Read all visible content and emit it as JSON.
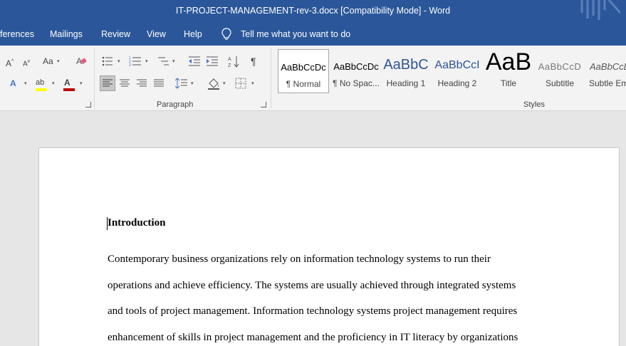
{
  "window": {
    "title": "IT-PROJECT-MANAGEMENT-rev-3.docx [Compatibility Mode]  -  Word"
  },
  "menu": {
    "items": [
      "ferences",
      "Mailings",
      "Review",
      "View",
      "Help"
    ],
    "tell_me": "Tell me what you want to do"
  },
  "ribbon": {
    "paragraph_label": "Paragraph",
    "styles_label": "Styles",
    "styles": [
      {
        "preview": "AaBbCcDc",
        "label": "¶ Normal"
      },
      {
        "preview": "AaBbCcDc",
        "label": "¶ No Spac..."
      },
      {
        "preview": "AaBbC",
        "label": "Heading 1"
      },
      {
        "preview": "AaBbCcI",
        "label": "Heading 2"
      },
      {
        "preview": "AaB",
        "label": "Title"
      },
      {
        "preview": "AaBbCcD",
        "label": "Subtitle"
      },
      {
        "preview": "AaBbCcDc",
        "label": "Subtle Em"
      }
    ],
    "font_size_icons": [
      "A^",
      "A˅",
      "Aa"
    ],
    "colors": {
      "highlight": "#ffff00",
      "font_color": "#c00000",
      "accent": "#2b579a"
    }
  },
  "document": {
    "heading": "Introduction",
    "paragraph_lines": [
      "Contemporary business organizations rely on information technology systems to run their",
      "operations and achieve efficiency. The systems are usually achieved through integrated systems",
      "and tools of project management. Information technology systems project management requires",
      "enhancement of skills in project management and the proficiency in IT literacy by organizations"
    ]
  }
}
